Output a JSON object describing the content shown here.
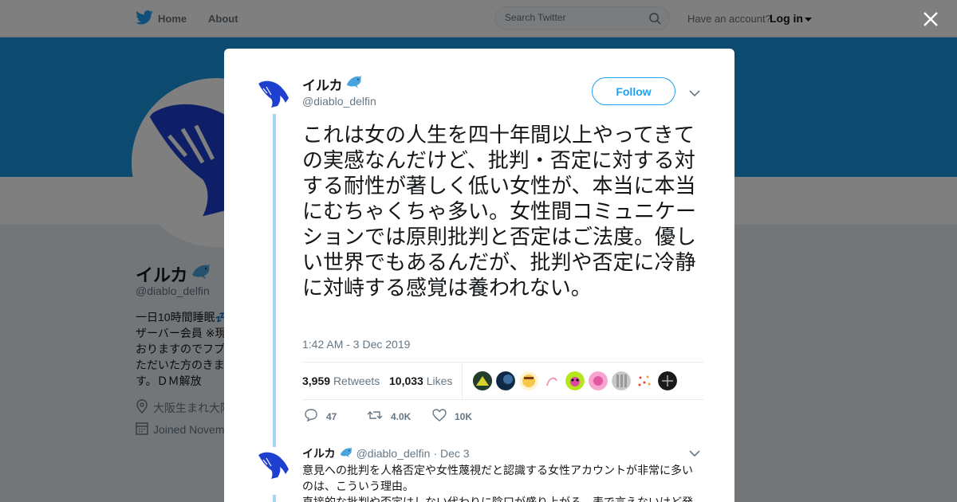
{
  "nav": {
    "home_label": "Home",
    "about_label": "About",
    "search_placeholder": "Search Twitter",
    "have_account": "Have an account?",
    "login_label": "Log in"
  },
  "profile": {
    "name": "イルカ",
    "handle": "@diablo_delfin",
    "bio": "一日10時間睡眠💤ザーバー会員 ※現ておりますのでフプいただいた方のきます。ＤＭ解放",
    "location": "大阪生まれ大阪",
    "joined": "Joined Novem"
  },
  "tweet": {
    "author_name": "イルカ",
    "author_handle": "@diablo_delfin",
    "follow_label": "Follow",
    "text": "これは女の人生を四十年間以上やってきての実感なんだけど、批判・否定に対する対する耐性が著しく低い女性が、本当に本当にむちゃくちゃ多い。女性間コミュニケーションでは原則批判と否定はご法度。優しい世界でもあるんだが、批判や否定に冷静に対峙する感覚は養われない。",
    "timestamp": "1:42 AM - 3 Dec 2019",
    "retweets_count": "3,959",
    "retweets_label": "Retweets",
    "likes_count": "10,033",
    "likes_label": "Likes",
    "replies_action": "47",
    "retweets_action": "4.0K",
    "likes_action": "10K"
  },
  "reply": {
    "author_name": "イルカ",
    "author_handle": "@diablo_delfin",
    "date": "· Dec 3",
    "text": "意見への批判を人格否定や女性蔑視だと認識する女性アカウントが非常に多いのは、こういう理由。\n直接的な批判や否定はしない代わりに陰口が盛り上がる。表で言えないけど発"
  },
  "colors": {
    "accent": "#1da1f2",
    "banner": "#1b95e0",
    "thread_line": "#a6d5f3",
    "avatar_blue": "#1e3fcf"
  }
}
